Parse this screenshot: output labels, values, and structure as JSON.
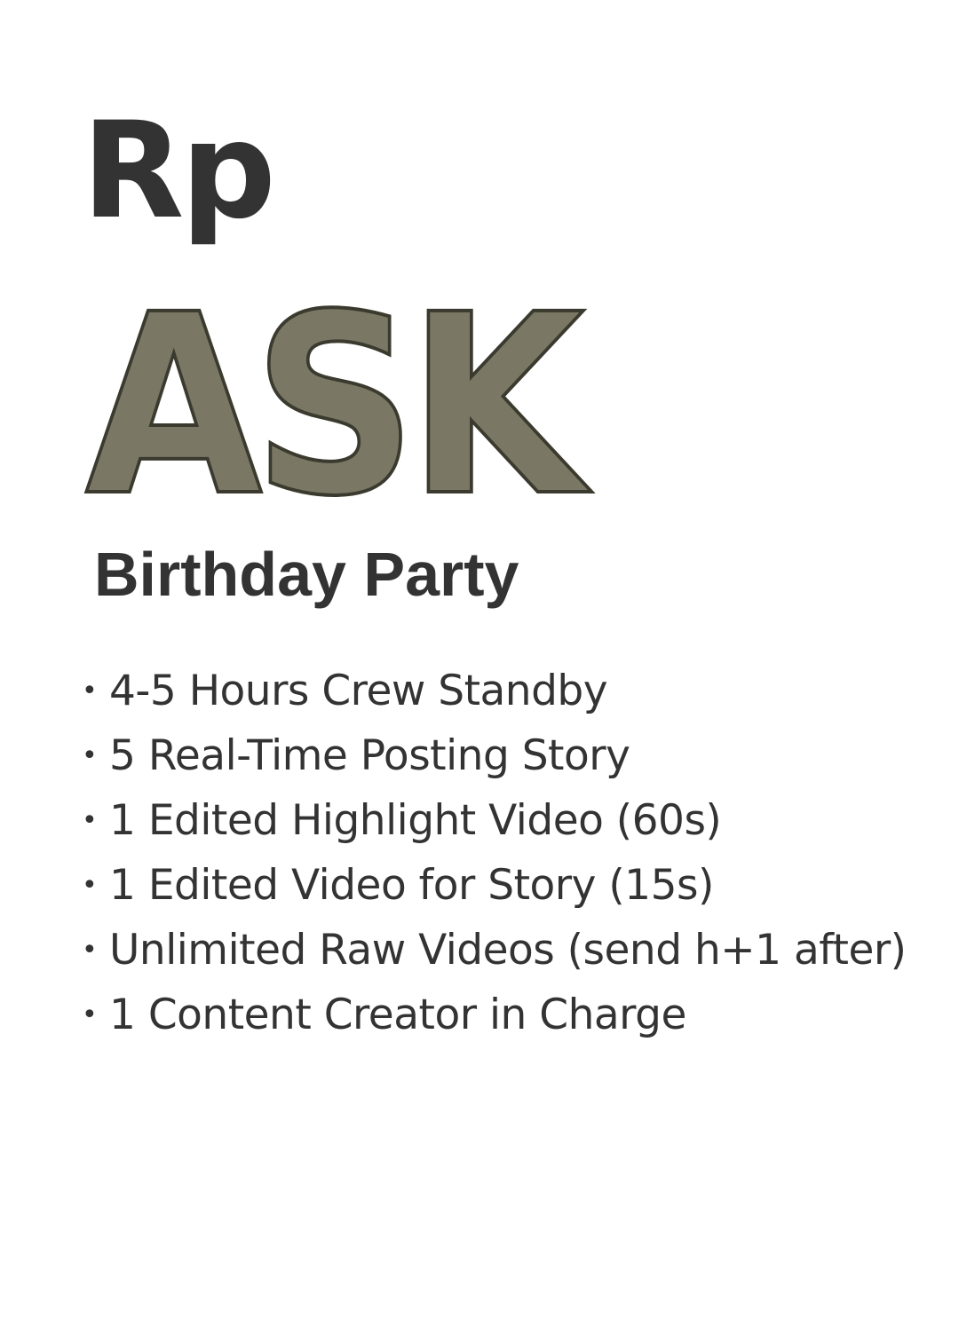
{
  "currency": "Rp",
  "price": "ASK",
  "package_title": "Birthday Party",
  "bullet_char": "•",
  "features": [
    "4-5 Hours Crew Standby",
    "5 Real-Time Posting Story",
    "1 Edited Highlight Video (60s)",
    "1 Edited Video for Story (15s)",
    "Unlimited Raw Videos (send h+1 after)",
    "1 Content Creator in Charge"
  ],
  "colors": {
    "text": "#333333",
    "price_fill": "#7a7765",
    "price_outline": "#3b3a2e",
    "background": "#ffffff"
  }
}
